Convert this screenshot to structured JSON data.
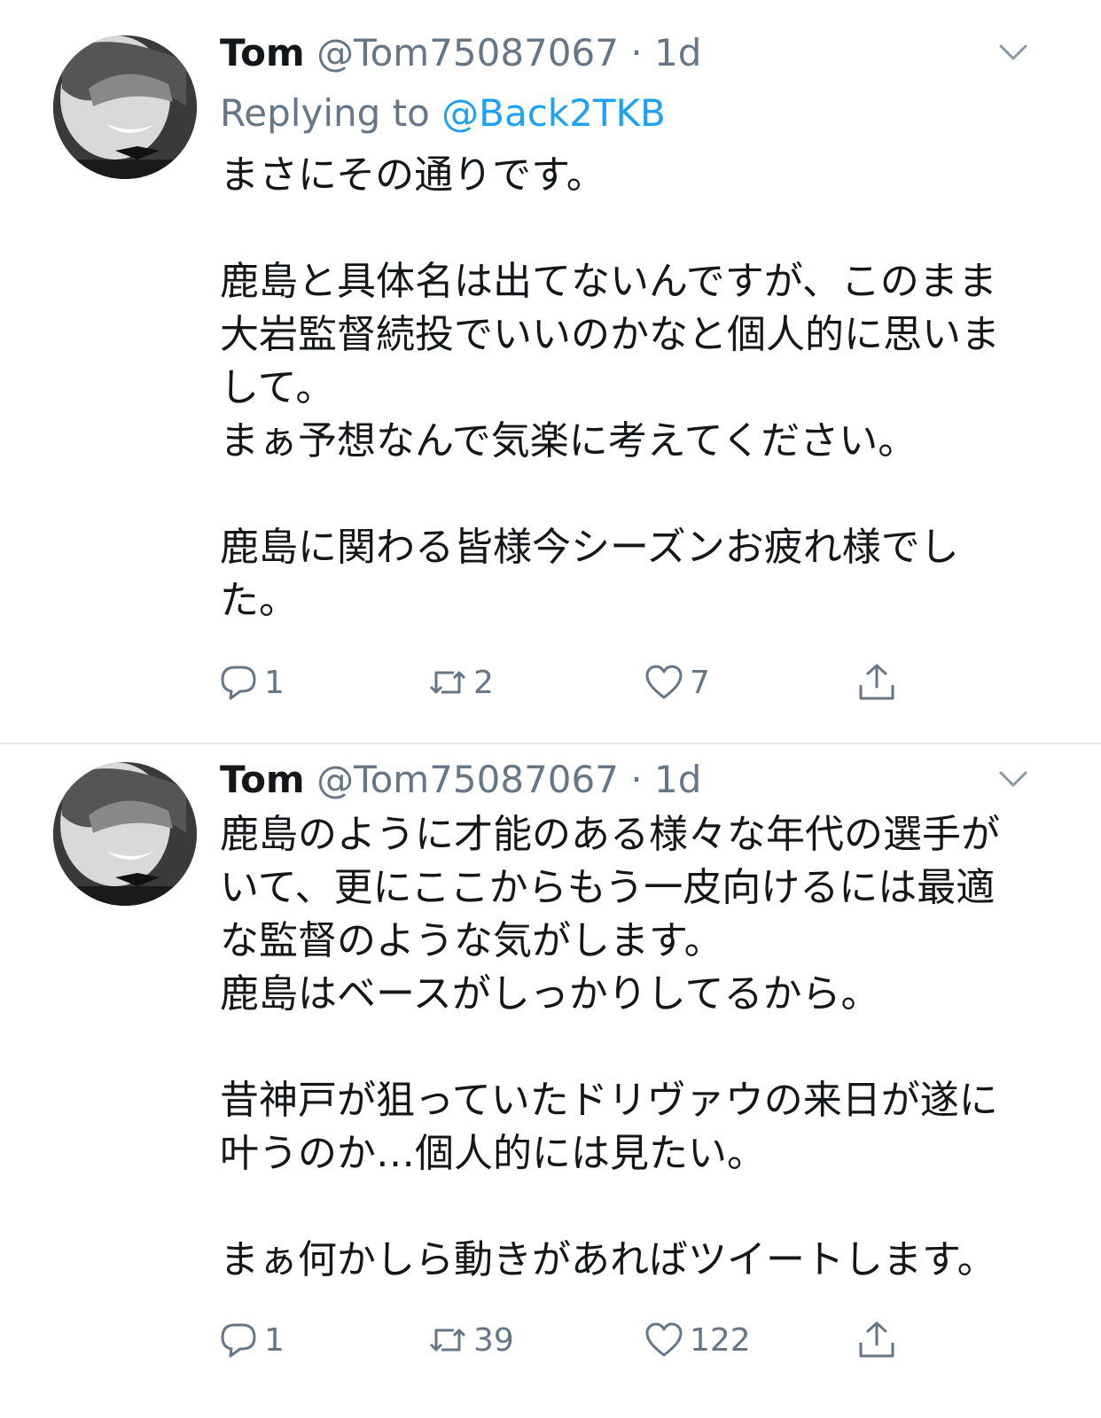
{
  "tweets": [
    {
      "name": "Tom",
      "handle": "@Tom75087067",
      "separator": "·",
      "time": "1d",
      "replying_prefix": "Replying to",
      "replying_to": "@Back2TKB",
      "lines": [
        "まさにその通りです。",
        "",
        "鹿島と具体名は出てないんですが、このまま",
        "大岩監督続投でいいのかなと個人的に思いま",
        "して。",
        "まぁ予想なんで気楽に考えてください。",
        "",
        "鹿島に関わる皆様今シーズンお疲れ様でし",
        "た。"
      ],
      "replies": "1",
      "retweets": "2",
      "likes": "7"
    },
    {
      "name": "Tom",
      "handle": "@Tom75087067",
      "separator": "·",
      "time": "1d",
      "lines": [
        "鹿島のように才能のある様々な年代の選手が",
        "いて、更にここからもう一皮向けるには最適",
        "な監督のような気がします。",
        "鹿島はベースがしっかりしてるから。",
        "",
        "昔神戸が狙っていたドリヴァウの来日が遂に",
        "叶うのか…個人的には見たい。",
        "",
        "まぁ何かしら動きがあればツイートします。"
      ],
      "replies": "1",
      "retweets": "39",
      "likes": "122"
    }
  ],
  "icons": {
    "avatar": "profile-photo",
    "caret": "chevron-down-icon",
    "reply": "reply-bubble-icon",
    "retweet": "retweet-icon",
    "like": "heart-icon",
    "share": "share-icon"
  },
  "colors": {
    "text": "#14171a",
    "secondary": "#657786",
    "link": "#1da1f2",
    "divider": "#e6ecf0"
  }
}
